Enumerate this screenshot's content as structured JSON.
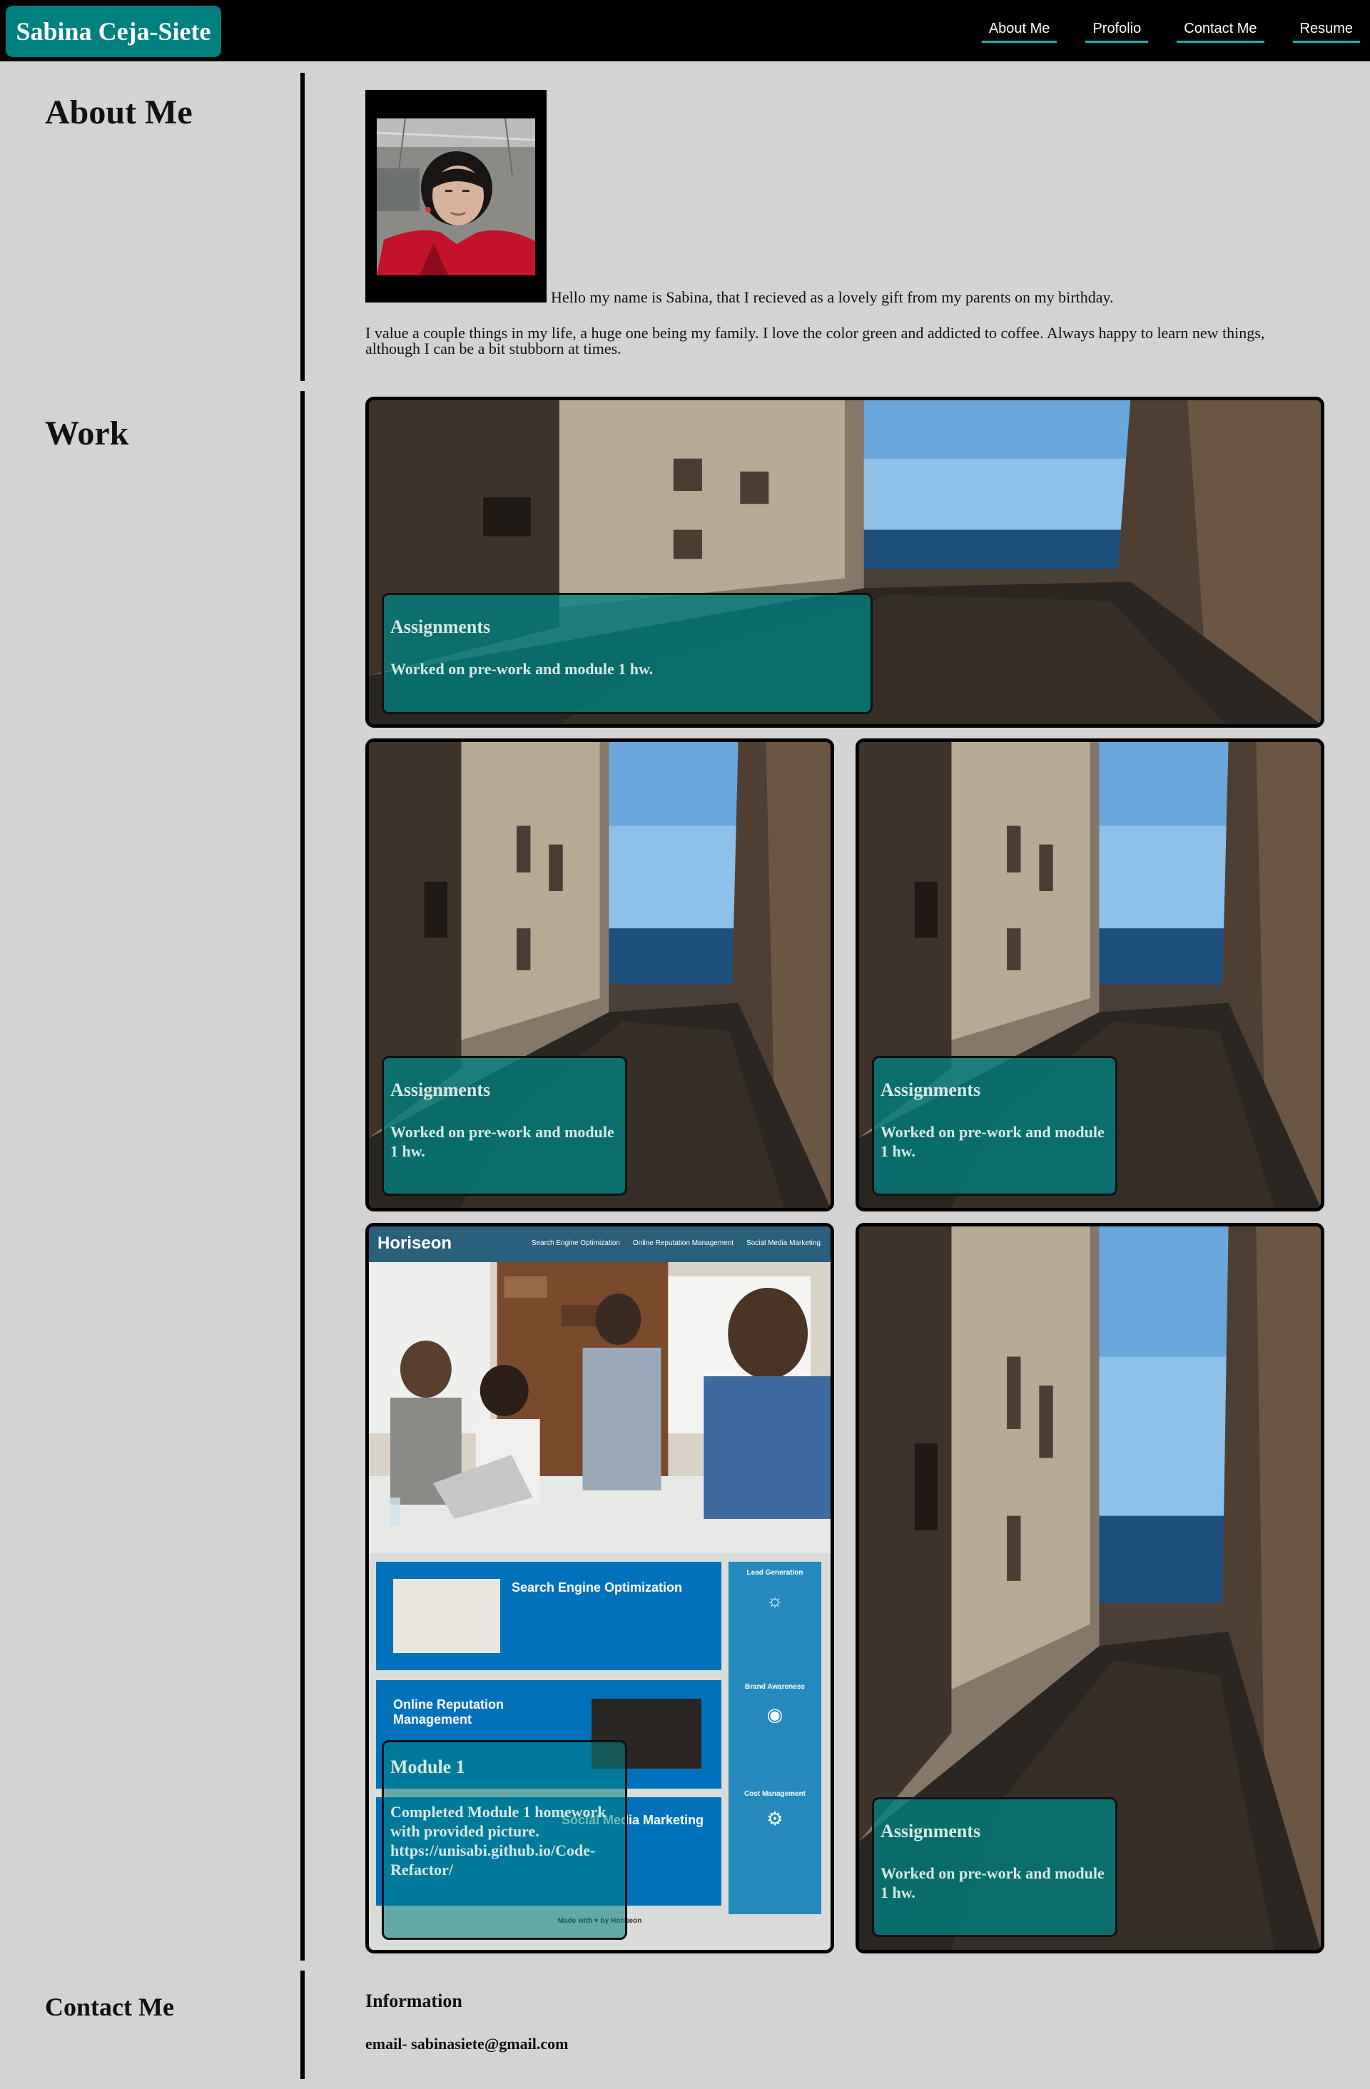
{
  "header": {
    "brand": "Sabina Ceja-Siete",
    "nav": [
      "About Me",
      "Profolio",
      "Contact Me",
      "Resume"
    ],
    "brand_color": "#008080",
    "nav_underline_color": "#20b2aa"
  },
  "about": {
    "title": "About Me",
    "intro": "Hello my name is Sabina, that I recieved as a lovely gift from my parents on my birthday.",
    "paragraph": "I value a couple things in my life, a huge one being my family. I love the color green and addicted to coffee. Always happy to learn new things, although I can be a bit stubborn at times."
  },
  "work": {
    "title": "Work",
    "cards": [
      {
        "title": "Assignments",
        "text": "Worked on pre-work and module 1 hw."
      },
      {
        "title": "Assignments",
        "text": "Worked on pre-work and module 1 hw."
      },
      {
        "title": "Assignments",
        "text": "Worked on pre-work and module 1 hw."
      },
      {
        "title": "Module 1",
        "text": "Completed Module 1 homework with provided picture. https://unisabi.github.io/Code-Refactor/"
      },
      {
        "title": "Assignments",
        "text": "Worked on pre-work and module 1 hw."
      }
    ],
    "horiseon": {
      "logo": "Horiseon",
      "nav": [
        "Search Engine Optimization",
        "Online Reputation Management",
        "Social Media Marketing"
      ],
      "seo_title": "Search Engine Optimization",
      "orm_title": "Online Reputation Management",
      "smm_title": "Social Media Marketing",
      "side": [
        "Lead Generation",
        "Brand Awareness",
        "Cost Management"
      ],
      "footer": "Made with ♥ by Horiseon"
    }
  },
  "contact": {
    "title": "Contact Me",
    "heading": "Information",
    "email": "email- sabinasiete@gmail.com"
  }
}
